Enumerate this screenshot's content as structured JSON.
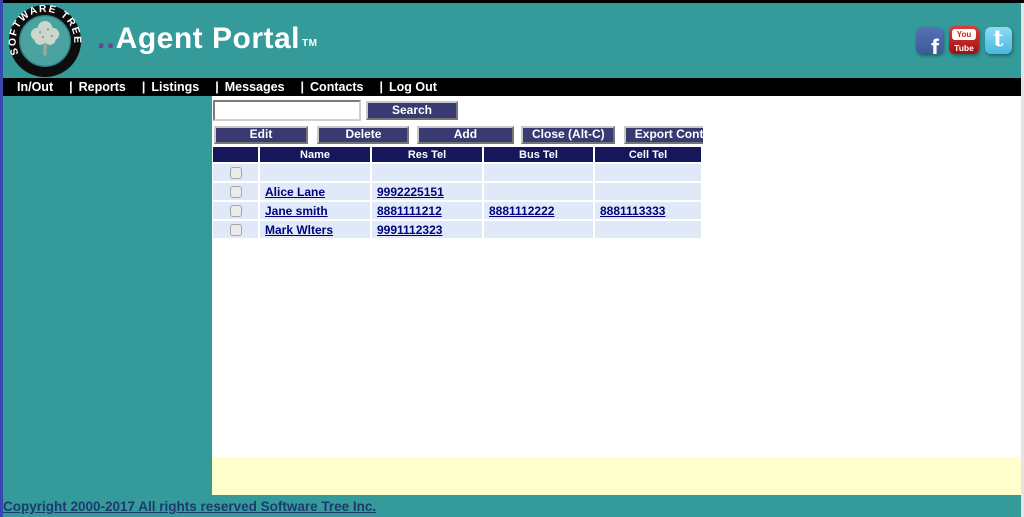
{
  "brand": {
    "arc_text": "SOFTWARE TREE",
    "title_dots": "..",
    "title": "Agent Portal",
    "trademark": "TM"
  },
  "social": {
    "facebook_glyph": "f",
    "youtube_line1": "You",
    "youtube_line2": "Tube",
    "twitter_glyph": "t"
  },
  "nav": {
    "separator": "|",
    "items": [
      "In/Out",
      "Reports",
      "Listings",
      "Messages",
      "Contacts",
      "Log Out"
    ]
  },
  "search": {
    "value": "",
    "button_label": "Search"
  },
  "toolbar": {
    "buttons": [
      "Edit",
      "Delete",
      "Add",
      "Close (Alt-C)",
      "Export Contact"
    ]
  },
  "contacts": {
    "columns": [
      "",
      "Name",
      "Res Tel",
      "Bus Tel",
      "Cell Tel"
    ],
    "rows": [
      {
        "name": "",
        "res_tel": "",
        "bus_tel": "",
        "cell_tel": ""
      },
      {
        "name": "Alice Lane",
        "res_tel": "9992225151",
        "bus_tel": "",
        "cell_tel": ""
      },
      {
        "name": "Jane smith",
        "res_tel": "8881111212",
        "bus_tel": "8881112222",
        "cell_tel": "8881113333"
      },
      {
        "name": "Mark Wlters",
        "res_tel": "9991112323",
        "bus_tel": "",
        "cell_tel": ""
      }
    ]
  },
  "footer": {
    "copyright": "Copyright 2000-2017 All rights reserved Software Tree Inc."
  },
  "colors": {
    "teal": "#349a9a",
    "nav_black": "#000000",
    "button_navy": "#3a3a72",
    "table_header_navy": "#16165c",
    "row_blue": "#dfe9f8",
    "link_navy": "#00007e",
    "highlight_yellow": "#ffffcc",
    "title_dots_purple": "#6f4191"
  }
}
